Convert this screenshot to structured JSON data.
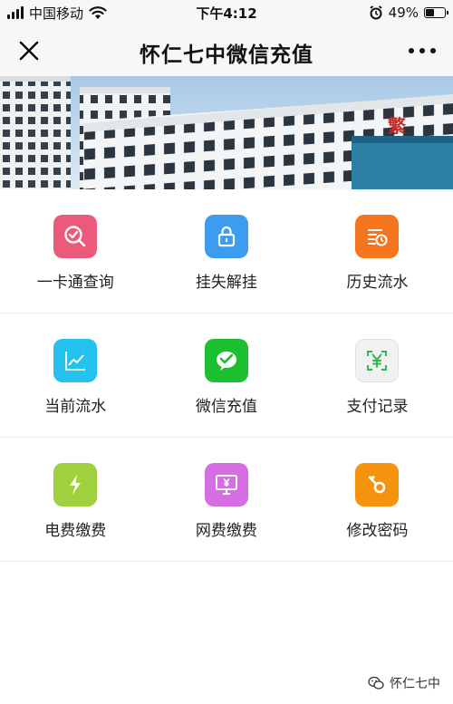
{
  "status_bar": {
    "carrier": "中国移动",
    "time": "下午4:12",
    "battery_text": "49%",
    "battery_level": 0.49,
    "icons": [
      "signal-icon",
      "wifi-icon",
      "alarm-icon",
      "battery-icon"
    ]
  },
  "nav": {
    "title": "怀仁七中微信充值",
    "close_icon": "close-icon",
    "more_icon": "more-icon"
  },
  "banner": {
    "sign_char": "繁"
  },
  "menu": {
    "rows": [
      [
        {
          "label": "一卡通查询",
          "icon": "search-check-icon",
          "color": "#eb5a7a"
        },
        {
          "label": "挂失解挂",
          "icon": "lock-icon",
          "color": "#3d9bf0"
        },
        {
          "label": "历史流水",
          "icon": "history-list-icon",
          "color": "#f5751f"
        }
      ],
      [
        {
          "label": "当前流水",
          "icon": "line-chart-icon",
          "color": "#23c2ef"
        },
        {
          "label": "微信充值",
          "icon": "wechat-pay-icon",
          "color": "#1cbf30"
        },
        {
          "label": "支付记录",
          "icon": "yuan-scan-icon",
          "color": "#f1f1f1"
        }
      ],
      [
        {
          "label": "电费缴费",
          "icon": "lightning-icon",
          "color": "#9fd13f"
        },
        {
          "label": "网费缴费",
          "icon": "monitor-yuan-icon",
          "color": "#d46ee2"
        },
        {
          "label": "修改密码",
          "icon": "key-icon",
          "color": "#f5920e"
        }
      ]
    ]
  },
  "watermark": {
    "text": "怀仁七中",
    "icon": "wechat-logo-icon"
  }
}
